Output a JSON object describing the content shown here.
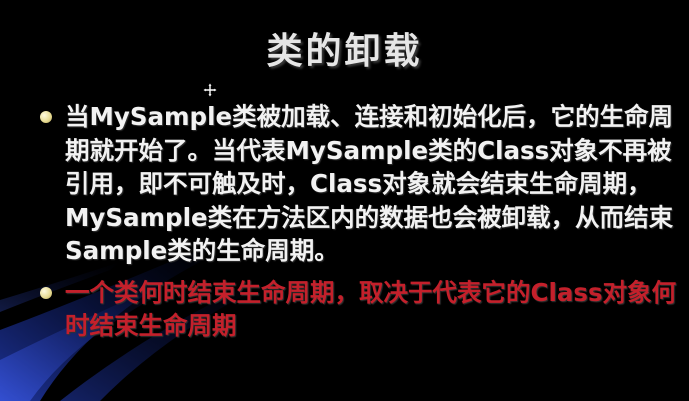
{
  "slide": {
    "title": "类的卸载",
    "bullets": [
      {
        "text": "当MySample类被加载、连接和初始化后，它的生命周期就开始了。当代表MySample类的Class对象不再被引用，即不可触及时，Class对象就会结束生命周期，MySample类在方法区内的数据也会被卸载，从而结束Sample类的生命周期。",
        "color": "#f2f2f2"
      },
      {
        "text": "一个类何时结束生命周期，取决于代表它的Class对象何时结束生命周期",
        "color": "#c4202b"
      }
    ]
  },
  "icons": {
    "cursor": "move-cursor-icon",
    "bullet": "round-bullet-icon"
  },
  "colors": {
    "background": "#000000",
    "title": "#e6e6e6",
    "accent_blue": "#1f3fc4"
  }
}
